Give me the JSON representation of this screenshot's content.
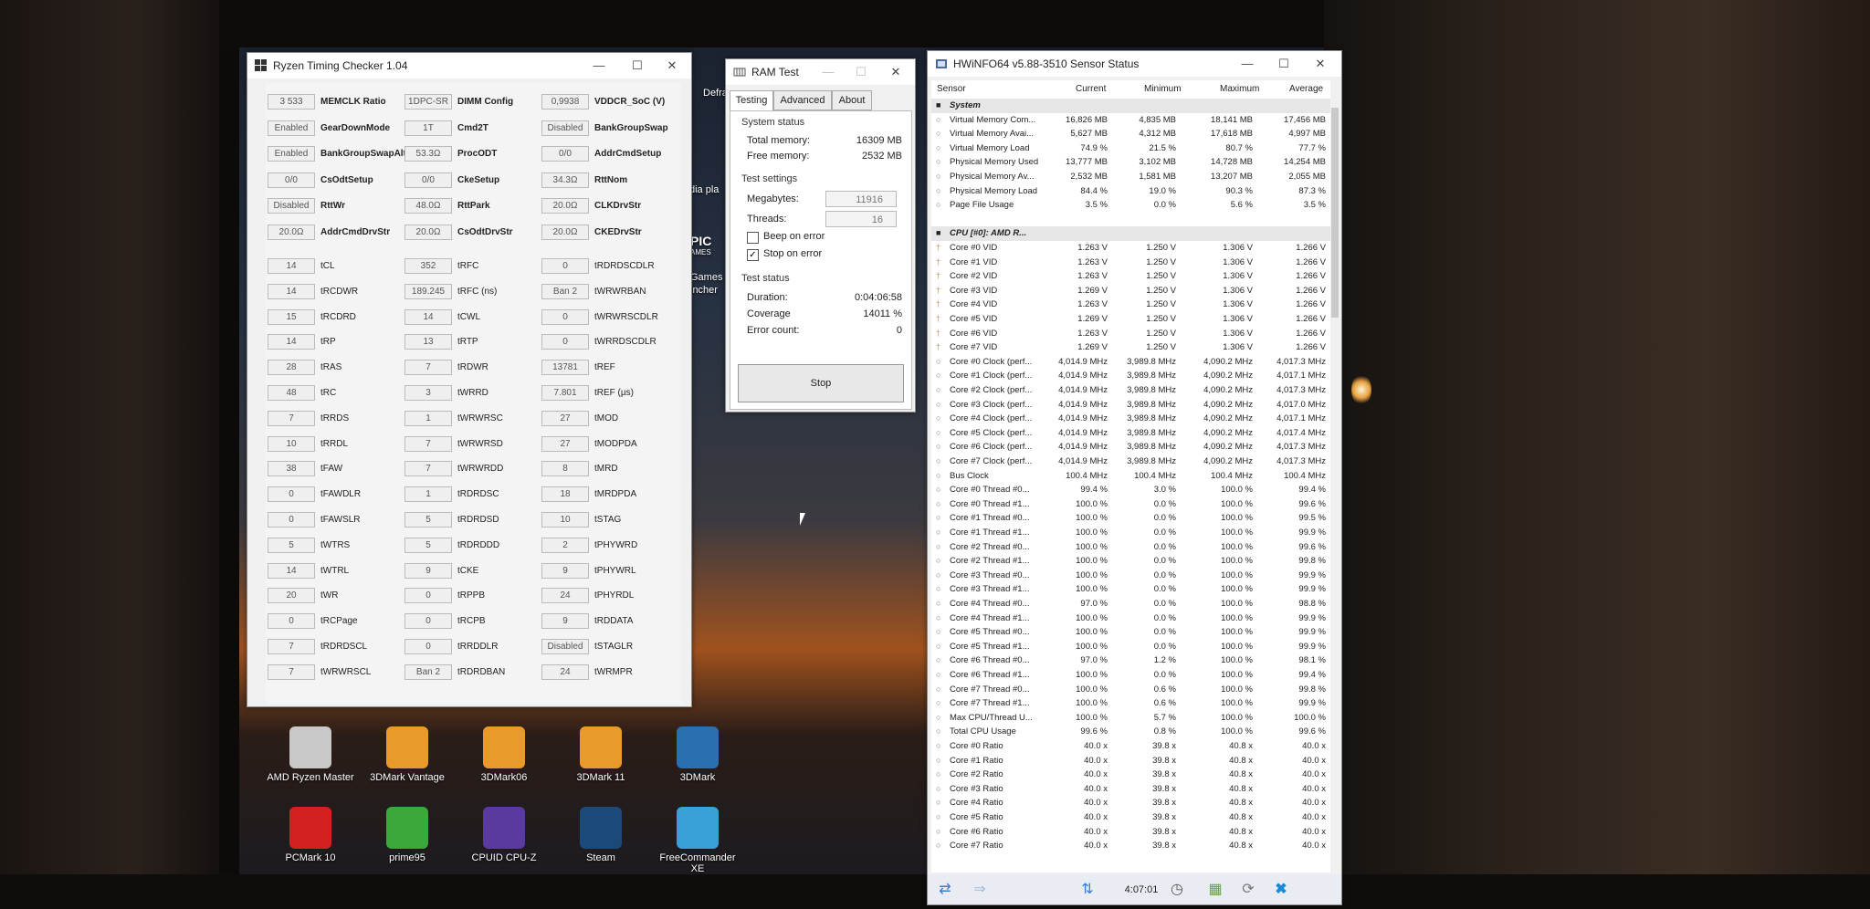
{
  "rtc": {
    "title": "Ryzen Timing Checker 1.04",
    "top_rows": [
      [
        [
          "3 533",
          "MEMCLK Ratio"
        ],
        [
          "1DPC-SR",
          "DIMM Config"
        ],
        [
          "0,9938",
          "VDDCR_SoC (V)"
        ]
      ],
      [
        [
          "Enabled",
          "GearDownMode"
        ],
        [
          "1T",
          "Cmd2T"
        ],
        [
          "Disabled",
          "BankGroupSwap"
        ]
      ],
      [
        [
          "Enabled",
          "BankGroupSwapAlt"
        ],
        [
          "53.3Ω",
          "ProcODT"
        ],
        [
          "0/0",
          "AddrCmdSetup"
        ]
      ],
      [
        [
          "0/0",
          "CsOdtSetup"
        ],
        [
          "0/0",
          "CkeSetup"
        ],
        [
          "34.3Ω",
          "RttNom"
        ]
      ],
      [
        [
          "Disabled",
          "RttWr"
        ],
        [
          "48.0Ω",
          "RttPark"
        ],
        [
          "20.0Ω",
          "CLKDrvStr"
        ]
      ],
      [
        [
          "20.0Ω",
          "AddrCmdDrvStr"
        ],
        [
          "20.0Ω",
          "CsOdtDrvStr"
        ],
        [
          "20.0Ω",
          "CKEDrvStr"
        ]
      ]
    ],
    "timing_rows": [
      [
        [
          "14",
          "tCL"
        ],
        [
          "352",
          "tRFC"
        ],
        [
          "0",
          "tRDRDSCDLR"
        ]
      ],
      [
        [
          "14",
          "tRCDWR"
        ],
        [
          "189.245",
          "tRFC (ns)"
        ],
        [
          "Ban 2",
          "tWRWRBAN"
        ]
      ],
      [
        [
          "15",
          "tRCDRD"
        ],
        [
          "14",
          "tCWL"
        ],
        [
          "0",
          "tWRWRSCDLR"
        ]
      ],
      [
        [
          "14",
          "tRP"
        ],
        [
          "13",
          "tRTP"
        ],
        [
          "0",
          "tWRRDSCDLR"
        ]
      ],
      [
        [
          "28",
          "tRAS"
        ],
        [
          "7",
          "tRDWR"
        ],
        [
          "13781",
          "tREF"
        ]
      ],
      [
        [
          "48",
          "tRC"
        ],
        [
          "3",
          "tWRRD"
        ],
        [
          "7.801",
          "tREF (µs)"
        ]
      ],
      [
        [
          "7",
          "tRRDS"
        ],
        [
          "1",
          "tWRWRSC"
        ],
        [
          "27",
          "tMOD"
        ]
      ],
      [
        [
          "10",
          "tRRDL"
        ],
        [
          "7",
          "tWRWRSD"
        ],
        [
          "27",
          "tMODPDA"
        ]
      ],
      [
        [
          "38",
          "tFAW"
        ],
        [
          "7",
          "tWRWRDD"
        ],
        [
          "8",
          "tMRD"
        ]
      ],
      [
        [
          "0",
          "tFAWDLR"
        ],
        [
          "1",
          "tRDRDSC"
        ],
        [
          "18",
          "tMRDPDA"
        ]
      ],
      [
        [
          "0",
          "tFAWSLR"
        ],
        [
          "5",
          "tRDRDSD"
        ],
        [
          "10",
          "tSTAG"
        ]
      ],
      [
        [
          "5",
          "tWTRS"
        ],
        [
          "5",
          "tRDRDDD"
        ],
        [
          "2",
          "tPHYWRD"
        ]
      ],
      [
        [
          "14",
          "tWTRL"
        ],
        [
          "9",
          "tCKE"
        ],
        [
          "9",
          "tPHYWRL"
        ]
      ],
      [
        [
          "20",
          "tWR"
        ],
        [
          "0",
          "tRPPB"
        ],
        [
          "24",
          "tPHYRDL"
        ]
      ],
      [
        [
          "0",
          "tRCPage"
        ],
        [
          "0",
          "tRCPB"
        ],
        [
          "9",
          "tRDDATA"
        ]
      ],
      [
        [
          "7",
          "tRDRDSCL"
        ],
        [
          "0",
          "tRRDDLR"
        ],
        [
          "Disabled",
          "tSTAGLR"
        ]
      ],
      [
        [
          "7",
          "tWRWRSCL"
        ],
        [
          "Ban 2",
          "tRDRDBAN"
        ],
        [
          "24",
          "tWRMPR"
        ]
      ]
    ]
  },
  "ramtest": {
    "title": "RAM Test",
    "tabs": [
      "Testing",
      "Advanced",
      "About"
    ],
    "status_group": "System status",
    "total_label": "Total memory:",
    "total_value": "16309 MB",
    "free_label": "Free memory:",
    "free_value": "2532 MB",
    "settings_group": "Test settings",
    "megabytes_label": "Megabytes:",
    "megabytes_value": "11916",
    "threads_label": "Threads:",
    "threads_value": "16",
    "beep_label": "Beep on error",
    "stop_label": "Stop on error",
    "teststatus_group": "Test status",
    "duration_label": "Duration:",
    "duration_value": "0:04:06:58",
    "coverage_label": "Coverage",
    "coverage_value": "14011 %",
    "errors_label": "Error count:",
    "errors_value": "0",
    "stop_button": "Stop"
  },
  "hwinfo": {
    "title": "HWiNFO64 v5.88-3510 Sensor Status",
    "columns": [
      "Sensor",
      "Current",
      "Minimum",
      "Maximum",
      "Average"
    ],
    "footer_time": "4:07:01",
    "rows": [
      {
        "type": "sec",
        "name": "System"
      },
      {
        "name": "Virtual Memory Com...",
        "v": [
          "16,826 MB",
          "4,835 MB",
          "18,141 MB",
          "17,456 MB"
        ]
      },
      {
        "name": "Virtual Memory Avai...",
        "v": [
          "5,627 MB",
          "4,312 MB",
          "17,618 MB",
          "4,997 MB"
        ]
      },
      {
        "name": "Virtual Memory Load",
        "v": [
          "74.9 %",
          "21.5 %",
          "80.7 %",
          "77.7 %"
        ]
      },
      {
        "name": "Physical Memory Used",
        "v": [
          "13,777 MB",
          "3,102 MB",
          "14,728 MB",
          "14,254 MB"
        ]
      },
      {
        "name": "Physical Memory Av...",
        "v": [
          "2,532 MB",
          "1,581 MB",
          "13,207 MB",
          "2,055 MB"
        ]
      },
      {
        "name": "Physical Memory Load",
        "v": [
          "84.4 %",
          "19.0 %",
          "90.3 %",
          "87.3 %"
        ]
      },
      {
        "name": "Page File Usage",
        "v": [
          "3.5 %",
          "0.0 %",
          "5.6 %",
          "3.5 %"
        ]
      },
      {
        "type": "blank"
      },
      {
        "type": "sec",
        "name": "CPU [#0]: AMD R..."
      },
      {
        "name": "Core #0 VID",
        "v": [
          "1.263 V",
          "1.250 V",
          "1.306 V",
          "1.266 V"
        ]
      },
      {
        "name": "Core #1 VID",
        "v": [
          "1.263 V",
          "1.250 V",
          "1.306 V",
          "1.266 V"
        ]
      },
      {
        "name": "Core #2 VID",
        "v": [
          "1.263 V",
          "1.250 V",
          "1.306 V",
          "1.266 V"
        ]
      },
      {
        "name": "Core #3 VID",
        "v": [
          "1.269 V",
          "1.250 V",
          "1.306 V",
          "1.266 V"
        ]
      },
      {
        "name": "Core #4 VID",
        "v": [
          "1.263 V",
          "1.250 V",
          "1.306 V",
          "1.266 V"
        ]
      },
      {
        "name": "Core #5 VID",
        "v": [
          "1.269 V",
          "1.250 V",
          "1.306 V",
          "1.266 V"
        ]
      },
      {
        "name": "Core #6 VID",
        "v": [
          "1.263 V",
          "1.250 V",
          "1.306 V",
          "1.266 V"
        ]
      },
      {
        "name": "Core #7 VID",
        "v": [
          "1.269 V",
          "1.250 V",
          "1.306 V",
          "1.266 V"
        ]
      },
      {
        "name": "Core #0 Clock (perf...",
        "v": [
          "4,014.9 MHz",
          "3,989.8 MHz",
          "4,090.2 MHz",
          "4,017.3 MHz"
        ]
      },
      {
        "name": "Core #1 Clock (perf...",
        "v": [
          "4,014.9 MHz",
          "3,989.8 MHz",
          "4,090.2 MHz",
          "4,017.1 MHz"
        ]
      },
      {
        "name": "Core #2 Clock (perf...",
        "v": [
          "4,014.9 MHz",
          "3,989.8 MHz",
          "4,090.2 MHz",
          "4,017.3 MHz"
        ]
      },
      {
        "name": "Core #3 Clock (perf...",
        "v": [
          "4,014.9 MHz",
          "3,989.8 MHz",
          "4,090.2 MHz",
          "4,017.0 MHz"
        ]
      },
      {
        "name": "Core #4 Clock (perf...",
        "v": [
          "4,014.9 MHz",
          "3,989.8 MHz",
          "4,090.2 MHz",
          "4,017.1 MHz"
        ]
      },
      {
        "name": "Core #5 Clock (perf...",
        "v": [
          "4,014.9 MHz",
          "3,989.8 MHz",
          "4,090.2 MHz",
          "4,017.4 MHz"
        ]
      },
      {
        "name": "Core #6 Clock (perf...",
        "v": [
          "4,014.9 MHz",
          "3,989.8 MHz",
          "4,090.2 MHz",
          "4,017.3 MHz"
        ]
      },
      {
        "name": "Core #7 Clock (perf...",
        "v": [
          "4,014.9 MHz",
          "3,989.8 MHz",
          "4,090.2 MHz",
          "4,017.3 MHz"
        ]
      },
      {
        "name": "Bus Clock",
        "v": [
          "100.4 MHz",
          "100.4 MHz",
          "100.4 MHz",
          "100.4 MHz"
        ]
      },
      {
        "name": "Core #0 Thread #0...",
        "v": [
          "99.4 %",
          "3.0 %",
          "100.0 %",
          "99.4 %"
        ]
      },
      {
        "name": "Core #0 Thread #1...",
        "v": [
          "100.0 %",
          "0.0 %",
          "100.0 %",
          "99.6 %"
        ]
      },
      {
        "name": "Core #1 Thread #0...",
        "v": [
          "100.0 %",
          "0.0 %",
          "100.0 %",
          "99.5 %"
        ]
      },
      {
        "name": "Core #1 Thread #1...",
        "v": [
          "100.0 %",
          "0.0 %",
          "100.0 %",
          "99.9 %"
        ]
      },
      {
        "name": "Core #2 Thread #0...",
        "v": [
          "100.0 %",
          "0.0 %",
          "100.0 %",
          "99.6 %"
        ]
      },
      {
        "name": "Core #2 Thread #1...",
        "v": [
          "100.0 %",
          "0.0 %",
          "100.0 %",
          "99.8 %"
        ]
      },
      {
        "name": "Core #3 Thread #0...",
        "v": [
          "100.0 %",
          "0.0 %",
          "100.0 %",
          "99.9 %"
        ]
      },
      {
        "name": "Core #3 Thread #1...",
        "v": [
          "100.0 %",
          "0.0 %",
          "100.0 %",
          "99.9 %"
        ]
      },
      {
        "name": "Core #4 Thread #0...",
        "v": [
          "97.0 %",
          "0.0 %",
          "100.0 %",
          "98.8 %"
        ]
      },
      {
        "name": "Core #4 Thread #1...",
        "v": [
          "100.0 %",
          "0.0 %",
          "100.0 %",
          "99.9 %"
        ]
      },
      {
        "name": "Core #5 Thread #0...",
        "v": [
          "100.0 %",
          "0.0 %",
          "100.0 %",
          "99.9 %"
        ]
      },
      {
        "name": "Core #5 Thread #1...",
        "v": [
          "100.0 %",
          "0.0 %",
          "100.0 %",
          "99.9 %"
        ]
      },
      {
        "name": "Core #6 Thread #0...",
        "v": [
          "97.0 %",
          "1.2 %",
          "100.0 %",
          "98.1 %"
        ]
      },
      {
        "name": "Core #6 Thread #1...",
        "v": [
          "100.0 %",
          "0.0 %",
          "100.0 %",
          "99.4 %"
        ]
      },
      {
        "name": "Core #7 Thread #0...",
        "v": [
          "100.0 %",
          "0.6 %",
          "100.0 %",
          "99.8 %"
        ]
      },
      {
        "name": "Core #7 Thread #1...",
        "v": [
          "100.0 %",
          "0.6 %",
          "100.0 %",
          "99.9 %"
        ]
      },
      {
        "name": "Max CPU/Thread U...",
        "v": [
          "100.0 %",
          "5.7 %",
          "100.0 %",
          "100.0 %"
        ]
      },
      {
        "name": "Total CPU Usage",
        "v": [
          "99.6 %",
          "0.8 %",
          "100.0 %",
          "99.6 %"
        ]
      },
      {
        "name": "Core #0 Ratio",
        "v": [
          "40.0 x",
          "39.8 x",
          "40.8 x",
          "40.0 x"
        ]
      },
      {
        "name": "Core #1 Ratio",
        "v": [
          "40.0 x",
          "39.8 x",
          "40.8 x",
          "40.0 x"
        ]
      },
      {
        "name": "Core #2 Ratio",
        "v": [
          "40.0 x",
          "39.8 x",
          "40.8 x",
          "40.0 x"
        ]
      },
      {
        "name": "Core #3 Ratio",
        "v": [
          "40.0 x",
          "39.8 x",
          "40.8 x",
          "40.0 x"
        ]
      },
      {
        "name": "Core #4 Ratio",
        "v": [
          "40.0 x",
          "39.8 x",
          "40.8 x",
          "40.0 x"
        ]
      },
      {
        "name": "Core #5 Ratio",
        "v": [
          "40.0 x",
          "39.8 x",
          "40.8 x",
          "40.0 x"
        ]
      },
      {
        "name": "Core #6 Ratio",
        "v": [
          "40.0 x",
          "39.8 x",
          "40.8 x",
          "40.0 x"
        ]
      },
      {
        "name": "Core #7 Ratio",
        "v": [
          "40.0 x",
          "39.8 x",
          "40.8 x",
          "40.0 x"
        ]
      }
    ]
  },
  "desktop": {
    "partial_labels": [
      "Defrag",
      "dia pla",
      "PIC",
      "AMES",
      "Games",
      "incher"
    ],
    "icons": [
      {
        "label": "AMD Ryzen Master",
        "color": "#c8c8c8"
      },
      {
        "label": "3DMark Vantage",
        "color": "#e89a2a"
      },
      {
        "label": "3DMark06",
        "color": "#e89a2a"
      },
      {
        "label": "3DMark 11",
        "color": "#e89a2a"
      },
      {
        "label": "3DMark",
        "color": "#2a6fb0"
      },
      {
        "label": "PCMark 10",
        "color": "#d42020"
      },
      {
        "label": "prime95",
        "color": "#3aa83a"
      },
      {
        "label": "CPUID CPU-Z",
        "color": "#5a3aa0"
      },
      {
        "label": "Steam",
        "color": "#1b4a7a"
      },
      {
        "label": "FreeCommander XE",
        "color": "#3aa0d8"
      }
    ]
  }
}
